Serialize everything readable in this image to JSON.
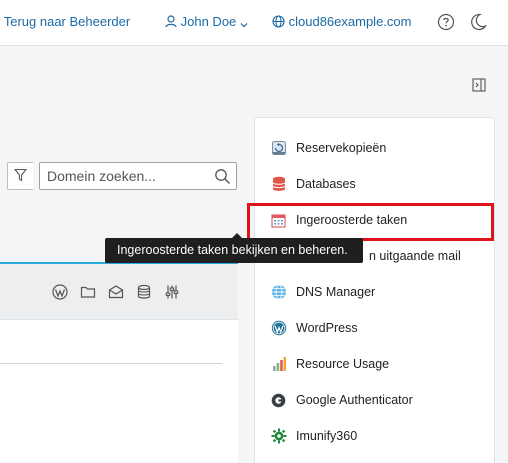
{
  "header": {
    "back_link": "Terug naar Beheerder",
    "user_name": "John Doe",
    "domain": "cloud86example.com"
  },
  "search": {
    "placeholder": "Domein zoeken..."
  },
  "tooltip": {
    "text": "Ingeroosterde taken bekijken en beheren."
  },
  "sidebar": {
    "items": [
      {
        "label": "Reservekopieën",
        "icon": "backup-icon"
      },
      {
        "label": "Databases",
        "icon": "database-icon"
      },
      {
        "label": "Ingeroosterde taken",
        "icon": "calendar-icon",
        "highlighted": true
      },
      {
        "label": "n uitgaande mail",
        "icon": "mail-icon"
      },
      {
        "label": "DNS Manager",
        "icon": "dns-icon"
      },
      {
        "label": "WordPress",
        "icon": "wordpress-icon"
      },
      {
        "label": "Resource Usage",
        "icon": "chart-icon"
      },
      {
        "label": "Google Authenticator",
        "icon": "authenticator-icon"
      },
      {
        "label": "Imunify360",
        "icon": "imunify-icon"
      }
    ]
  },
  "tools": [
    "wordpress-icon",
    "folder-icon",
    "mail-icon",
    "database-icon",
    "settings-sliders-icon"
  ],
  "colors": {
    "link": "#1b6aa6",
    "accent_line": "#28aade",
    "highlight_border": "#e0131a",
    "tooltip_bg": "#1f1f1f"
  }
}
